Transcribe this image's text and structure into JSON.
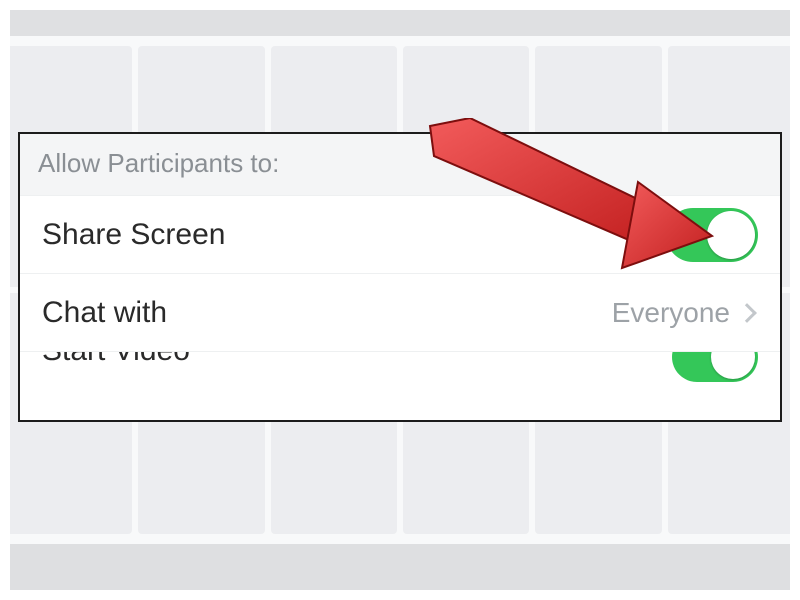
{
  "panel": {
    "header": "Allow Participants to:",
    "rows": [
      {
        "label": "Share Screen",
        "type": "toggle",
        "on": true
      },
      {
        "label": "Chat with",
        "type": "select",
        "value": "Everyone"
      },
      {
        "label": "Start Video",
        "type": "toggle",
        "on": true
      }
    ]
  },
  "colors": {
    "toggle_on": "#34c759",
    "arrow": "#e03131"
  }
}
